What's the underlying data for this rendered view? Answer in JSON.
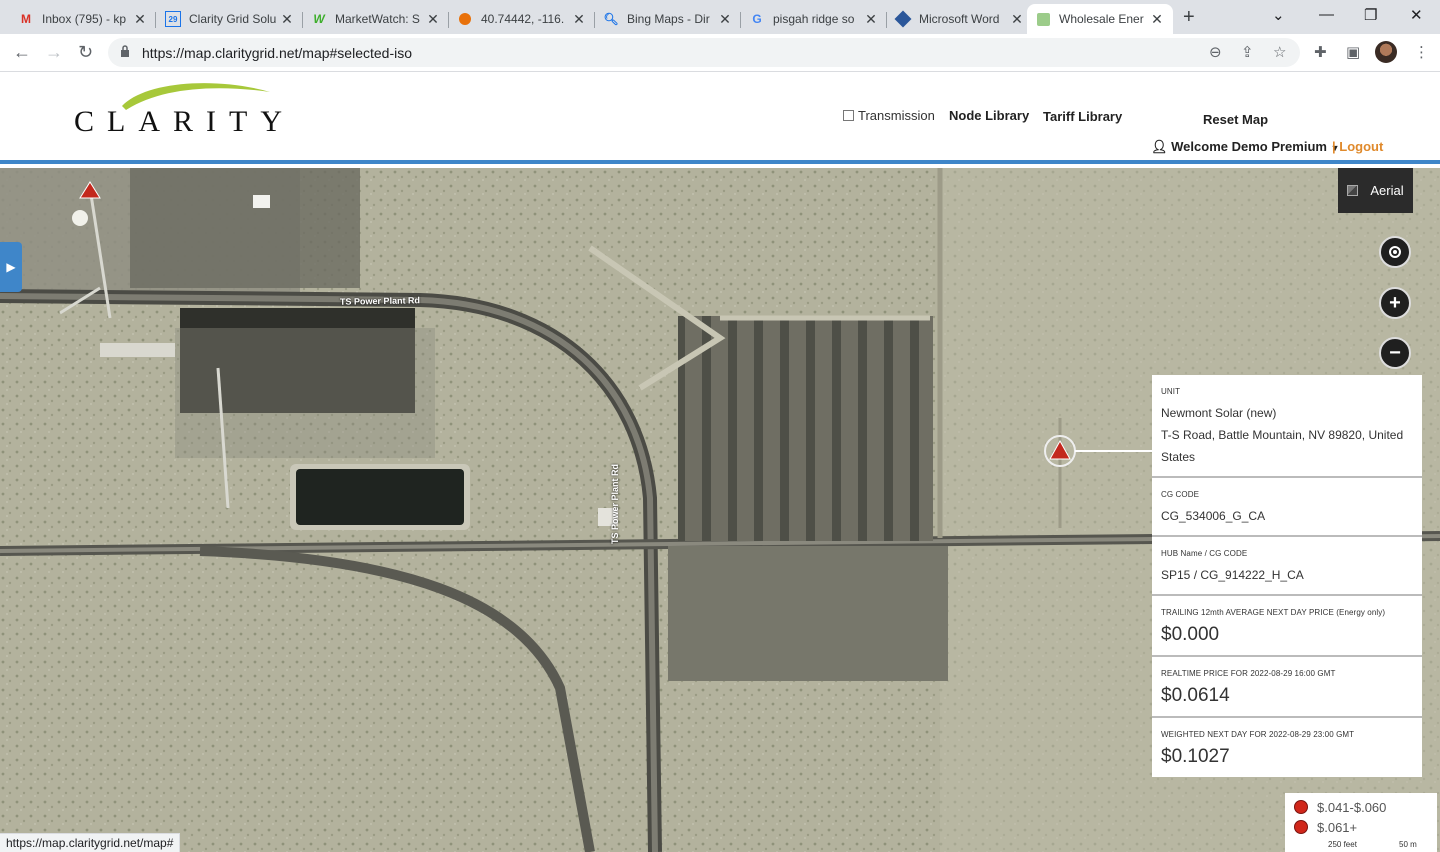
{
  "browser": {
    "tabs": [
      {
        "title": "Inbox (795) - kp",
        "icon": "gmail-icon",
        "color": "#d93025"
      },
      {
        "title": "Clarity Grid Solu",
        "icon": "calendar-icon",
        "color": "#1a73e8"
      },
      {
        "title": "MarketWatch: S",
        "icon": "marketwatch-icon",
        "color": "#3dae2b"
      },
      {
        "title": "40.74442, -116.",
        "icon": "location-icon",
        "color": "#e8710a"
      },
      {
        "title": "Bing Maps - Dir",
        "icon": "search-icon",
        "color": "#1a73e8"
      },
      {
        "title": "pisgah ridge so",
        "icon": "google-icon",
        "color": "#4285f4"
      },
      {
        "title": "Microsoft Word",
        "icon": "word-icon",
        "color": "#2b579a"
      },
      {
        "title": "Wholesale Ener",
        "icon": "page-icon",
        "color": "#9ccc8a"
      }
    ],
    "url": "https://map.claritygrid.net/map#selected-iso",
    "status_url": "https://map.claritygrid.net/map#"
  },
  "header": {
    "logo_text": "CLARITY",
    "transmission_label": "Transmission",
    "node_library": "Node Library",
    "tariff_library": "Tariff Library",
    "reset_map": "Reset Map",
    "welcome": "Welcome Demo Premium",
    "logout": "| Logout"
  },
  "map": {
    "layer_button": "Aerial",
    "road_label_1": "TS Power Plant Rd",
    "road_label_2": "TS Power Plant Rd",
    "scale_feet": "250 feet",
    "scale_m": "50 m"
  },
  "panel": {
    "unit_label": "UNIT",
    "unit_name": "Newmont Solar (new)",
    "unit_address": "T-S Road, Battle Mountain, NV 89820, United States",
    "cg_code_label": "CG CODE",
    "cg_code": "CG_534006_G_CA",
    "hub_label": "HUB Name / CG CODE",
    "hub_value": "SP15 / CG_914222_H_CA",
    "trailing_label": "TRAILING 12mth AVERAGE NEXT DAY PRICE (Energy only)",
    "trailing_value": "$0.000",
    "realtime_label": "REALTIME PRICE FOR 2022-08-29 16:00 GMT",
    "realtime_value": "$0.0614",
    "weighted_label": "WEIGHTED NEXT DAY FOR 2022-08-29 23:00 GMT",
    "weighted_value": "$0.1027"
  },
  "legend": [
    {
      "label": "$.041-$.060",
      "color": "#d0271b"
    },
    {
      "label": "$.061+",
      "color": "#d0271b"
    }
  ]
}
